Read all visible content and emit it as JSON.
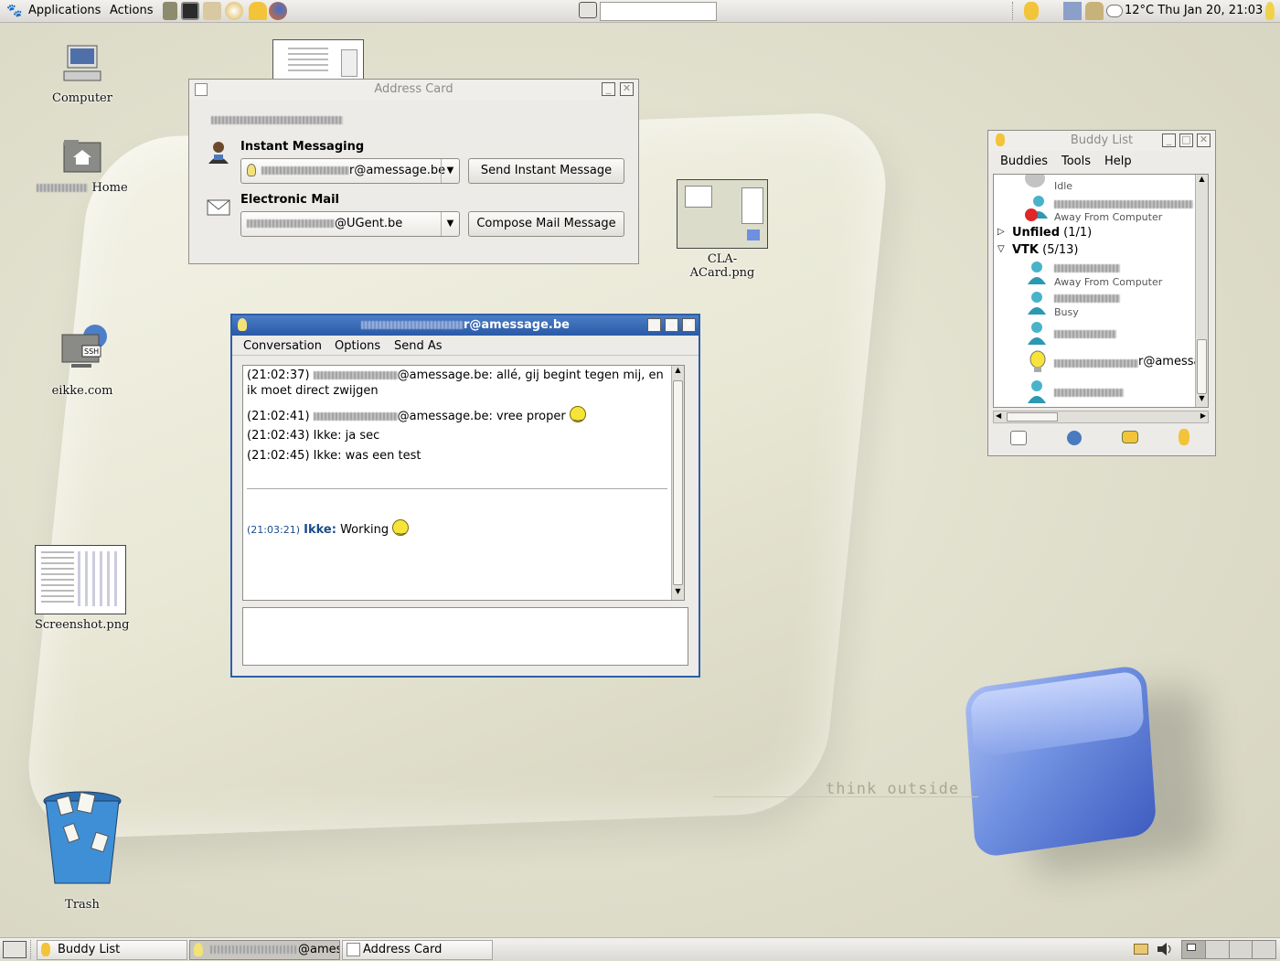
{
  "top_panel": {
    "applications": "Applications",
    "actions": "Actions",
    "weather": "12°C",
    "clock": "Thu Jan 20, 21:03"
  },
  "desktop": {
    "icons": {
      "computer": "Computer",
      "home": "Home",
      "ssh": "eikke.com",
      "acard": "CLA-ACard.png",
      "screenshot": "Screenshot.png",
      "trash": "Trash"
    },
    "wallpaper_text": "think outside"
  },
  "address_card": {
    "title": "Address Card",
    "im_heading": "Instant Messaging",
    "im_address_suffix": "r@amessage.be",
    "send_im_button": "Send Instant Message",
    "email_heading": "Electronic Mail",
    "email_suffix": "@UGent.be",
    "compose_button": "Compose Mail Message"
  },
  "conversation": {
    "title_suffix": "r@amessage.be",
    "menu": [
      "Conversation",
      "Options",
      "Send As"
    ],
    "lines": [
      {
        "time": "(21:02:37)",
        "text": "@amessage.be: allé, gij begint tegen mij, en",
        "cont": "ik moet direct zwijgen"
      },
      {
        "time": "(21:02:41)",
        "text": "@amessage.be: vree proper"
      },
      {
        "time": "(21:02:43)",
        "text": "Ikke: ja sec"
      },
      {
        "time": "(21:02:45)",
        "text": "Ikke: was een test"
      }
    ],
    "own": {
      "time": "(21:03:21)",
      "name": "Ikke:",
      "text": "Working"
    }
  },
  "buddy_list": {
    "title": "Buddy List",
    "menu": [
      "Buddies",
      "Tools",
      "Help"
    ],
    "entries": [
      {
        "status": "Idle"
      },
      {
        "status": "Away From Computer",
        "tail": "k"
      },
      {
        "group": "Unfiled",
        "count": "(1/1)"
      },
      {
        "group": "VTK",
        "count": "(5/13)"
      },
      {
        "status": "Away From Computer"
      },
      {
        "status": "Busy"
      },
      {
        "status": ""
      },
      {
        "name_suffix": "r@amessa"
      },
      {
        "status": ""
      }
    ]
  },
  "taskbar": {
    "items": [
      "Buddy List",
      "@ames",
      "Address Card"
    ]
  },
  "colors": {
    "conv_titlebar": "#2e5ea8",
    "own_name": "#1a4c8c",
    "own_time": "#1a4c8c"
  }
}
